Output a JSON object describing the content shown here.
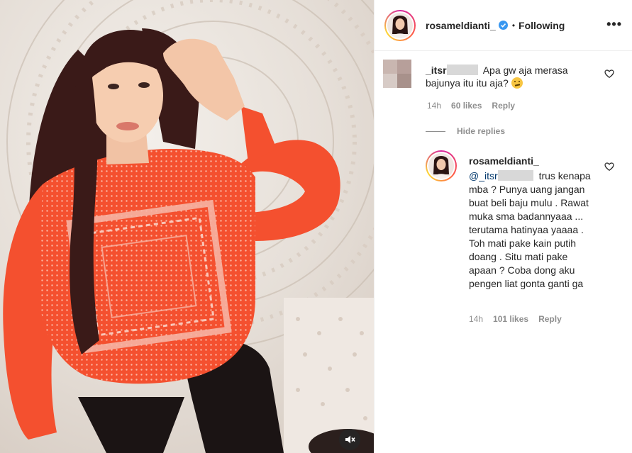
{
  "post": {
    "username": "rosameldianti_",
    "following_label": "Following",
    "more_icon": "more-horizontal-icon",
    "verified_icon": "verified-badge-icon"
  },
  "comments": [
    {
      "username": "_itsr",
      "text": "Apa gw aja merasa bajunya itu itu aja?",
      "time": "14h",
      "likes": "60 likes",
      "reply_label": "Reply"
    }
  ],
  "hide_replies_label": "Hide replies",
  "reply": {
    "username": "rosameldianti_",
    "mention": "@_itsr",
    "text": "trus kenapa mba ? Punya uang jangan buat beli baju mulu . Rawat muka sma badannyaaa ... terutama hatinyaa yaaaa . Toh mati pake kain putih doang . Situ mati pake apaan ? Coba dong aku pengen liat gonta ganti ga",
    "time": "14h",
    "likes": "101 likes",
    "reply_label": "Reply"
  },
  "colors": {
    "sweater": "#f4502f",
    "verified": "#3897f0",
    "secondary_text": "#8e8e8e"
  }
}
